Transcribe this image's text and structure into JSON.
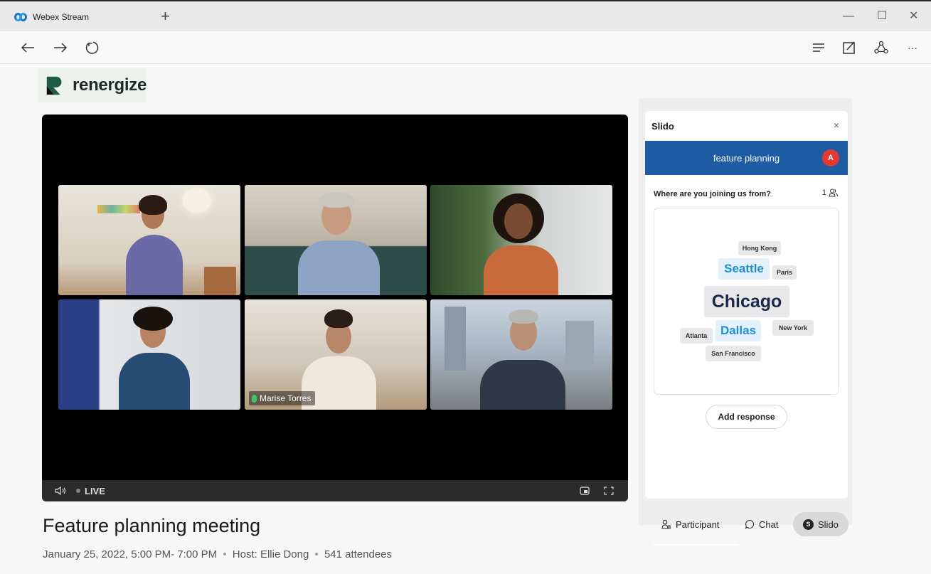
{
  "browser": {
    "tab_title": "Webex Stream",
    "new_tab": "+",
    "minimize": "—",
    "maximize": "☐",
    "close": "✕",
    "more": "···"
  },
  "brand": {
    "name": "renergize"
  },
  "video": {
    "participants": [
      "",
      "",
      "",
      "",
      "Marise Torres",
      ""
    ],
    "speaker_name": "Marise Torres",
    "live_label": "LIVE"
  },
  "meeting": {
    "title": "Feature planning meeting",
    "date": "January 25, 2022, 5:00 PM- 7:00 PM",
    "host": "Host: Ellie Dong",
    "attendees": "541 attendees",
    "separator": "•"
  },
  "slido": {
    "title": "Slido",
    "close": "×",
    "event_name": "feature planning",
    "avatar_initial": "A",
    "question": "Where are you joining us from?",
    "response_count": "1",
    "words": [
      {
        "text": "Hong Kong",
        "style": "gray"
      },
      {
        "text": "Seattle",
        "style": "blue"
      },
      {
        "text": "Paris",
        "style": "gray"
      },
      {
        "text": "Chicago",
        "style": "dark"
      },
      {
        "text": "Atlanta",
        "style": "gray"
      },
      {
        "text": "Dallas",
        "style": "blue"
      },
      {
        "text": "New York",
        "style": "gray"
      },
      {
        "text": "San Francisco",
        "style": "gray"
      }
    ],
    "add_response": "Add response"
  },
  "panel_tabs": {
    "participant": "Participant",
    "chat": "Chat",
    "slido": "Slido",
    "active": "slido"
  },
  "colors": {
    "slido_bar": "#1d5ba3",
    "avatar": "#e53935",
    "highlight_blue": "#1e8fd6",
    "speaker_outline": "#27a7d8"
  }
}
